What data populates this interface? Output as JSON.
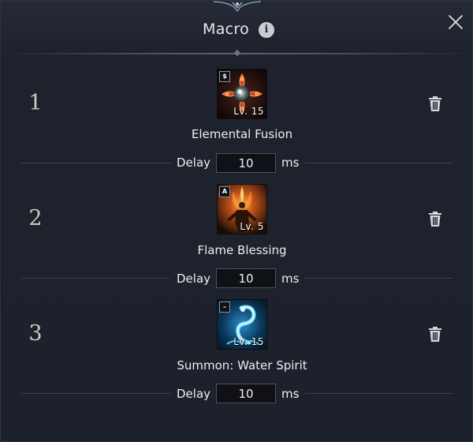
{
  "window": {
    "title": "Macro",
    "info_icon": "i",
    "close_icon": "close-icon"
  },
  "macros": [
    {
      "number": "1",
      "skill_name": "Elemental Fusion",
      "skill_level": "Lv. 15",
      "skill_type_badge": "$",
      "icon": "elemental-fusion-icon",
      "delay_label": "Delay",
      "delay_value": "10",
      "delay_unit": "ms"
    },
    {
      "number": "2",
      "skill_name": "Flame Blessing",
      "skill_level": "Lv. 5",
      "skill_type_badge": "A",
      "icon": "flame-blessing-icon",
      "delay_label": "Delay",
      "delay_value": "10",
      "delay_unit": "ms"
    },
    {
      "number": "3",
      "skill_name": "Summon: Water Spirit",
      "skill_level": "Lv. 15",
      "skill_type_badge": "–",
      "icon": "water-spirit-icon",
      "delay_label": "Delay",
      "delay_value": "10",
      "delay_unit": "ms"
    }
  ],
  "colors": {
    "background": "#1d212b",
    "text": "#eceef2",
    "number": "#cfc9b8",
    "divider": "#3c4250"
  }
}
